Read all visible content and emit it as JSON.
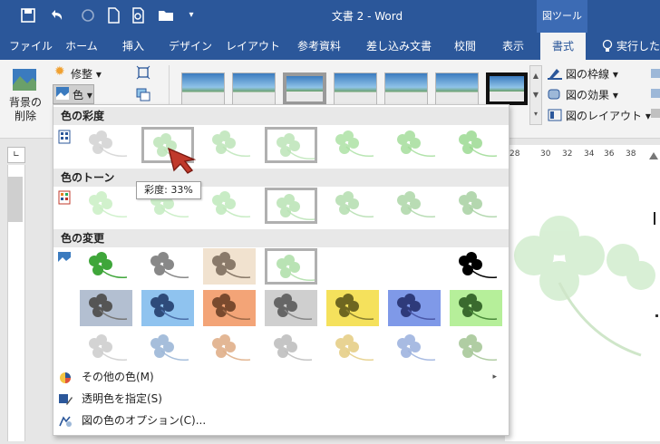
{
  "window": {
    "title": "文書 2 - Word",
    "tool_header": "図ツール"
  },
  "tabs": [
    {
      "label": "ファイル"
    },
    {
      "label": "ホーム"
    },
    {
      "label": "挿入"
    },
    {
      "label": "デザイン"
    },
    {
      "label": "レイアウト"
    },
    {
      "label": "参考資料"
    },
    {
      "label": "差し込み文書"
    },
    {
      "label": "校閲"
    },
    {
      "label": "表示"
    },
    {
      "label": "書式"
    },
    {
      "label": "実行したい"
    }
  ],
  "ribbon": {
    "remove_bg": "背景の削除",
    "adjust": "修整",
    "color": "色",
    "picture_border": "図の枠線",
    "picture_effects": "図の効果",
    "picture_layout": "図のレイアウト"
  },
  "ruler": {
    "ticks": [
      "28",
      "30",
      "32",
      "34",
      "36",
      "38"
    ]
  },
  "dropdown": {
    "saturation_title": "色の彩度",
    "tone_title": "色のトーン",
    "recolor_title": "色の変更",
    "tooltip": "彩度: 33%",
    "menu": [
      {
        "label": "その他の色(M)"
      },
      {
        "label": "透明色を指定(S)"
      },
      {
        "label": "図の色のオプション(C)..."
      }
    ]
  },
  "colors": {
    "accent": "#2b579a",
    "clover_green": "#4caf50"
  }
}
